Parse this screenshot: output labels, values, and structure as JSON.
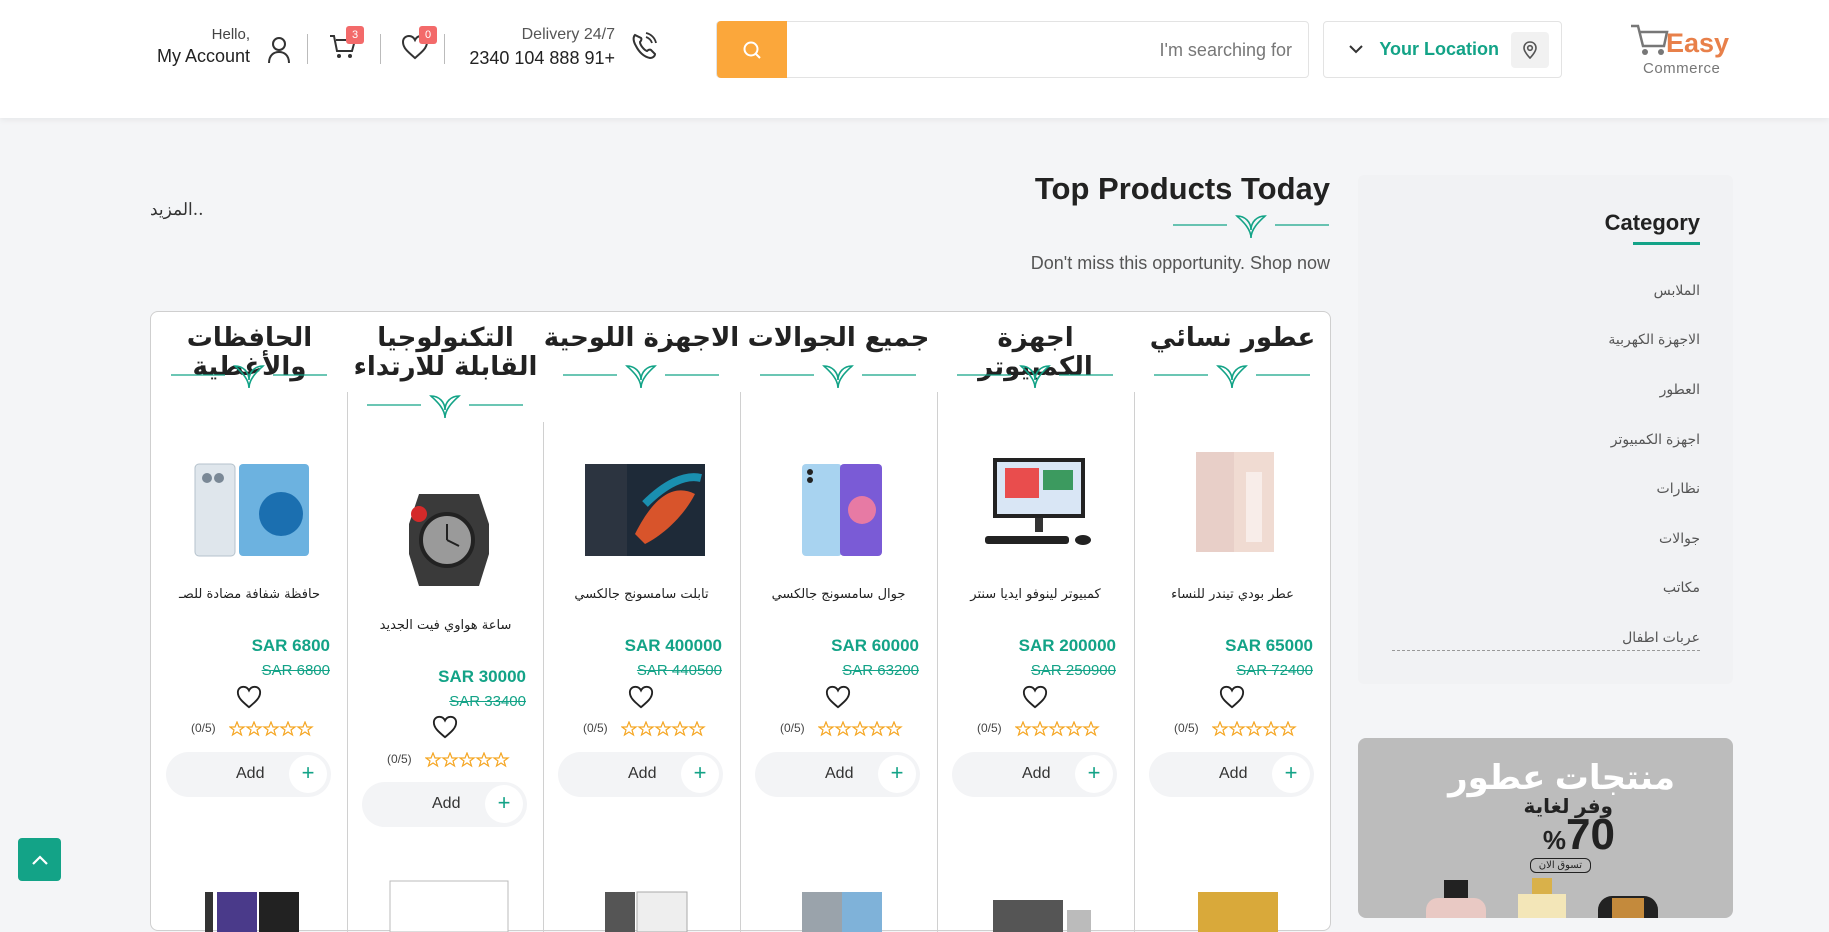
{
  "header": {
    "logo": {
      "word1": "Easy",
      "word2": "Commerce"
    },
    "location_label": "Your Location",
    "search_placeholder": "I'm searching for",
    "delivery_label": "Delivery 24/7",
    "phone": "2340 104 888 91+",
    "cart_count": "3",
    "wishlist_count": "0",
    "hello": "Hello,",
    "account": "My Account"
  },
  "sidebar": {
    "title": "Category",
    "categories": [
      "الملابس",
      "الاجهزة الكهربية",
      "العطور",
      "اجهزة الكمبيوتر",
      "نظارات",
      "جوالات",
      "مكاتب",
      "عربات اطفال"
    ]
  },
  "promo": {
    "line1": "منتجات عطور",
    "line2": "وفر لغاية",
    "discount": "70",
    "percent": "%",
    "cta": "تسوق الان"
  },
  "section": {
    "title": "Top Products Today",
    "subtitle": "Don't miss this opportunity. Shop now",
    "more": "المزيد.."
  },
  "columns": [
    {
      "title": "عطور نسائي",
      "product": "عطر بودي تيندر للنساء",
      "price": "SAR 65000",
      "old_price": "SAR 72400",
      "rating": "(0/5)",
      "add": "Add",
      "image": "perfume-bottle"
    },
    {
      "title": "اجهزة الكمبيوتر",
      "product": "كمبيوتر لينوفو ايديا سنتر",
      "price": "SAR 200000",
      "old_price": "SAR 250900",
      "rating": "(0/5)",
      "add": "Add",
      "image": "desktop-computer"
    },
    {
      "title": "جميع الجوالات",
      "product": "جوال سامسونج جالكسي",
      "price": "SAR 60000",
      "old_price": "SAR 63200",
      "rating": "(0/5)",
      "add": "Add",
      "image": "smartphone"
    },
    {
      "title": "الاجهزة اللوحية",
      "product": "تابلت سامسونج جالكسي",
      "price": "SAR 400000",
      "old_price": "SAR 440500",
      "rating": "(0/5)",
      "add": "Add",
      "image": "tablet"
    },
    {
      "title": "التكنولوجيا القابلة للارتداء",
      "product": "ساعة هواوي فيت الجديد",
      "price": "SAR 30000",
      "old_price": "SAR 33400",
      "rating": "(0/5)",
      "add": "Add",
      "image": "smartwatch"
    },
    {
      "title": "الحافظات والأغطية",
      "product": "حافظة شفافة مضادة للصـ",
      "price": "SAR 6800",
      "old_price": "SAR 6800",
      "rating": "(0/5)",
      "add": "Add",
      "image": "phone-case"
    }
  ],
  "colors": {
    "accent": "#13a387",
    "search_button": "#fba73b",
    "badge": "#f36a6a"
  }
}
